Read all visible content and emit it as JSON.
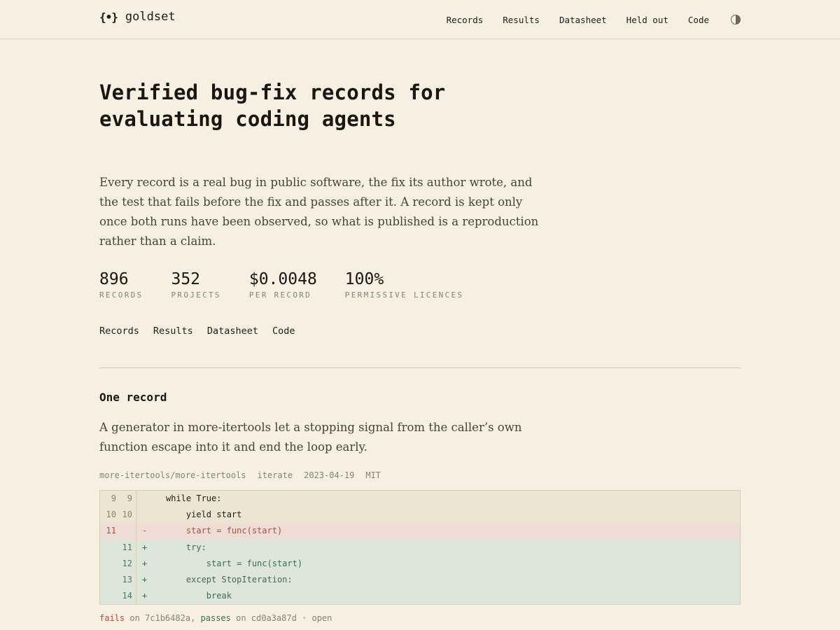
{
  "header": {
    "brand_icon": "{•}",
    "brand_name": "goldset",
    "nav": [
      "Records",
      "Results",
      "Datasheet",
      "Held out",
      "Code"
    ],
    "theme_icon": "contrast-icon"
  },
  "hero": {
    "title": "Verified bug-fix records for evaluating coding agents",
    "lede": "Every record is a real bug in public software, the fix its author wrote, and the test that fails before the fix and passes after it. A record is kept only once both runs have been observed, so what is published is a reproduction rather than a claim.",
    "stats": [
      {
        "value": "896",
        "label": "RECORDS"
      },
      {
        "value": "352",
        "label": "PROJECTS"
      },
      {
        "value": "$0.0048",
        "label": "PER RECORD"
      },
      {
        "value": "100%",
        "label": "PERMISSIVE LICENCES"
      }
    ],
    "links": [
      "Records",
      "Results",
      "Datasheet",
      "Code"
    ]
  },
  "record": {
    "section_title": "One record",
    "description": "A generator in more-itertools let a stopping signal from the caller’s own function escape into it and end the loop early.",
    "meta": {
      "repo": "more-itertools/more-itertools",
      "function": "iterate",
      "date": "2023-04-19",
      "license": "MIT"
    },
    "diff": [
      {
        "type": "ctx",
        "old": "9",
        "new": "9",
        "sign": "",
        "code": "while True:"
      },
      {
        "type": "ctx",
        "old": "10",
        "new": "10",
        "sign": "",
        "code": "    yield start"
      },
      {
        "type": "del",
        "old": "11",
        "new": "",
        "sign": "-",
        "code": "    start = func(start)"
      },
      {
        "type": "add",
        "old": "",
        "new": "11",
        "sign": "+",
        "code": "    try:"
      },
      {
        "type": "add",
        "old": "",
        "new": "12",
        "sign": "+",
        "code": "        start = func(start)"
      },
      {
        "type": "add",
        "old": "",
        "new": "13",
        "sign": "+",
        "code": "    except StopIteration:"
      },
      {
        "type": "add",
        "old": "",
        "new": "14",
        "sign": "+",
        "code": "        break"
      }
    ],
    "verify": {
      "fails_label": "fails",
      "on1": " on ",
      "fail_commit": "7c1b6482a",
      "sep": ", ",
      "passes_label": "passes",
      "on2": " on ",
      "pass_commit": "cd0a3a87d",
      "tail": " · open"
    }
  },
  "colors": {
    "background": "#f6efe2",
    "deleted": "#b5493c",
    "added": "#3f6b4e"
  }
}
